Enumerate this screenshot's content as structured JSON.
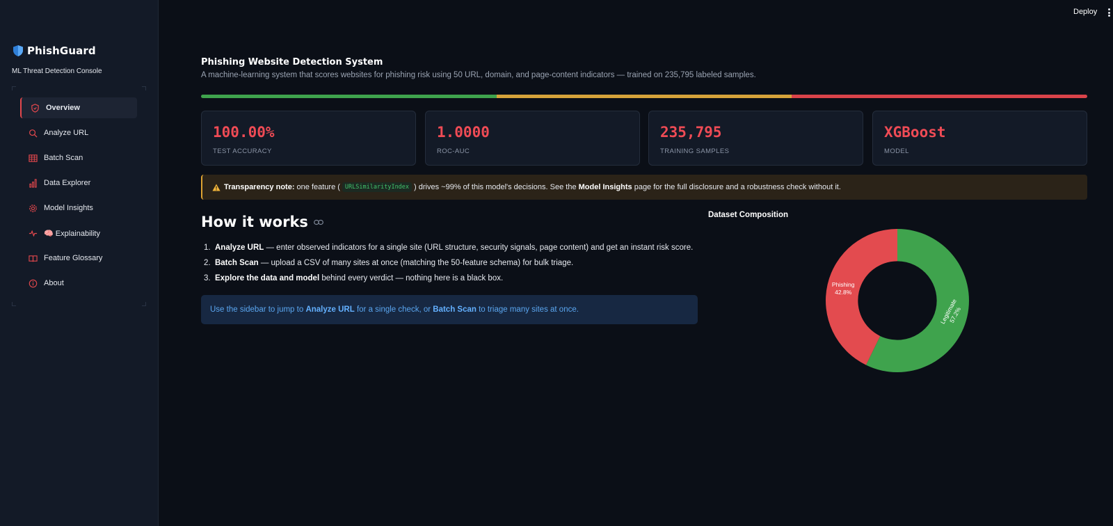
{
  "app": {
    "name": "PhishGuard",
    "subtitle": "ML Threat Detection Console",
    "deploy_label": "Deploy"
  },
  "sidebar": {
    "items": [
      {
        "label": "Overview",
        "icon": "shield-icon",
        "active": true
      },
      {
        "label": "Analyze URL",
        "icon": "search-icon"
      },
      {
        "label": "Batch Scan",
        "icon": "table-icon"
      },
      {
        "label": "Data Explorer",
        "icon": "bar-chart-icon"
      },
      {
        "label": "Model Insights",
        "icon": "gear-icon"
      },
      {
        "label": "🧠 Explainability",
        "icon": "pulse-icon"
      },
      {
        "label": "Feature Glossary",
        "icon": "book-icon"
      },
      {
        "label": "About",
        "icon": "info-icon"
      }
    ]
  },
  "header": {
    "title": "Phishing Website Detection System",
    "subtitle": "A machine-learning system that scores websites for phishing risk using 50 URL, domain, and page-content indicators — trained on 235,795 labeled samples."
  },
  "risk_bar": {
    "colors": [
      "#3fa34d",
      "#d6a33a",
      "#d9434a"
    ]
  },
  "metrics": [
    {
      "value": "100.00%",
      "label": "TEST ACCURACY"
    },
    {
      "value": "1.0000",
      "label": "ROC-AUC"
    },
    {
      "value": "235,795",
      "label": "TRAINING SAMPLES"
    },
    {
      "value": "XGBoost",
      "label": "MODEL"
    }
  ],
  "warning": {
    "icon": "warning-icon",
    "lead": "Transparency note:",
    "text1": "one feature (",
    "code": "URLSimilarityIndex",
    "text2": ") drives ~99% of this model's decisions. See the",
    "link": "Model Insights",
    "text3": "page for the full disclosure and a robustness check without it."
  },
  "how_it_works": {
    "heading": "How it works",
    "steps": [
      {
        "num": "1.",
        "bold": "Analyze URL",
        "text": " — enter observed indicators for a single site (URL structure, security signals, page content) and get an instant risk score."
      },
      {
        "num": "2.",
        "bold": "Batch Scan",
        "text": " — upload a CSV of many sites at once (matching the 50-feature schema) for bulk triage."
      },
      {
        "num": "3.",
        "bold": "Explore the data and model",
        "text": " behind every verdict — nothing here is a black box."
      }
    ],
    "info": {
      "text1": "Use the sidebar to jump to",
      "link1": "Analyze URL",
      "text2": "for a single check, or",
      "link2": "Batch Scan",
      "text3": "to triage many sites at once."
    }
  },
  "chart_data": {
    "type": "pie",
    "title": "Dataset Composition",
    "categories": [
      "Legitimate",
      "Phishing"
    ],
    "values": [
      57.2,
      42.8
    ],
    "labels": [
      "57.2%",
      "42.8%"
    ],
    "colors": [
      "#3fa34d",
      "#e34b4f"
    ],
    "hole": 0.55
  }
}
